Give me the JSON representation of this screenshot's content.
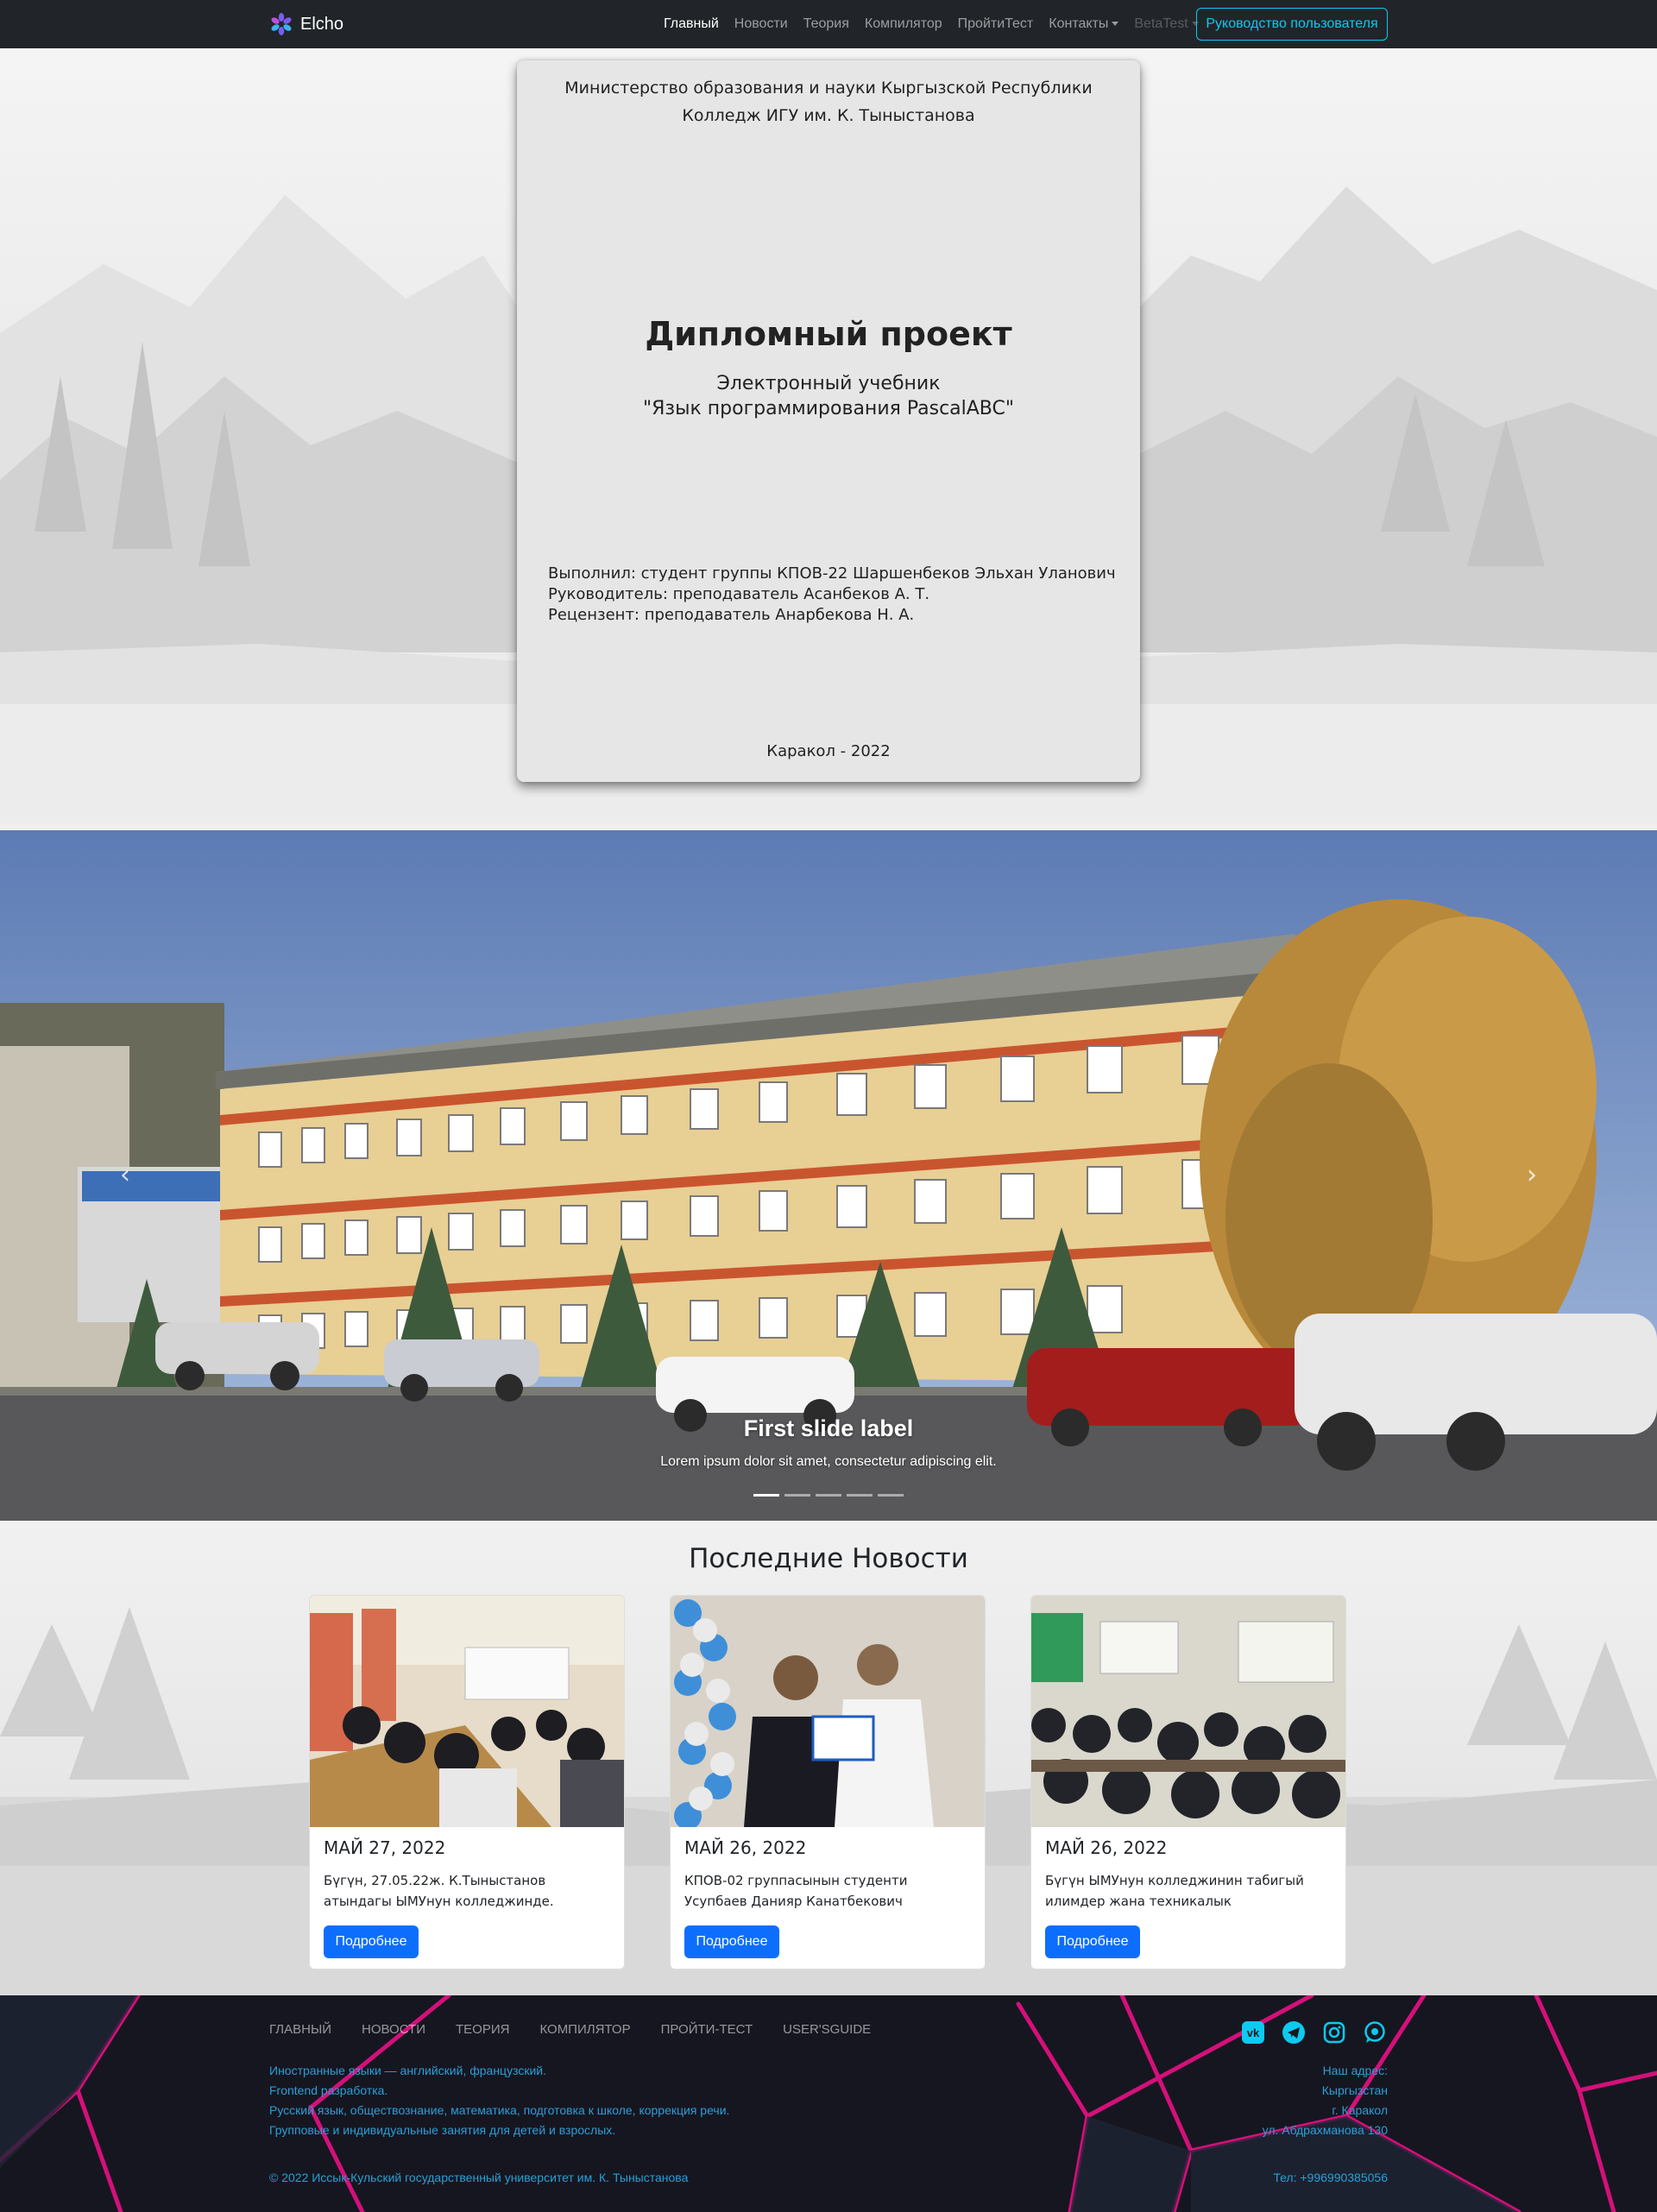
{
  "navbar": {
    "brand": "Elcho",
    "brand_icon": "snowflake-logo-icon",
    "links": [
      {
        "label": "Главный",
        "state": "active"
      },
      {
        "label": "Новости",
        "state": "normal"
      },
      {
        "label": "Теория",
        "state": "normal"
      },
      {
        "label": "Компилятор",
        "state": "normal"
      },
      {
        "label": "ПройтиТест",
        "state": "normal"
      },
      {
        "label": "Контакты",
        "state": "dropdown"
      },
      {
        "label": "BetaTest",
        "state": "disabled-dropdown"
      }
    ],
    "guide_button": "Руководство пользователя",
    "accent": "#0dcaf0"
  },
  "title_page": {
    "ministry": "Министерство образования и науки Кыргызской Республики",
    "college": "Колледж ИГУ им. К. Тыныстанова",
    "title": "Дипломный проект",
    "subtitle": "Электронный учебник",
    "subtitle_2": "\"Язык программирования PascalABC\"",
    "author": "Выполнил: студент группы КПОВ-22 Шаршенбеков Эльхан Уланович",
    "supervisor": "Руководитель: преподаватель Асанбеков А. Т.",
    "reviewer": "Рецензент: преподаватель Анарбекова Н. А.",
    "city_year": "Каракол - 2022"
  },
  "carousel": {
    "caption_title": "First slide label",
    "caption_text": "Lorem ipsum dolor sit amet, consectetur adipiscing elit.",
    "slides_count": 5,
    "active_index": 0,
    "prev_icon": "chevron-left-icon",
    "next_icon": "chevron-right-icon"
  },
  "news": {
    "heading": "Последние Новости",
    "cards": [
      {
        "date": "МАЙ 27, 2022",
        "text": "Бүгүн, 27.05.22ж. К.Тыныстанов атындагы ЫМУнун колледжинде.",
        "button": "Подробнее"
      },
      {
        "date": "МАЙ 26, 2022",
        "text": "КПОВ-02 группасынын студенти Усупбаев Данияр Канатбекович",
        "button": "Подробнее"
      },
      {
        "date": "МАЙ 26, 2022",
        "text": "Бүгүн ЫМУнун колледжинин табигый илимдер жана техникалык",
        "button": "Подробнее"
      }
    ],
    "button_color": "#0d6efd"
  },
  "footer": {
    "links": [
      "Главный",
      "Новости",
      "Теория",
      "Компилятор",
      "Пройти-тест",
      "User'sGuide"
    ],
    "social": [
      "vk-icon",
      "telegram-icon",
      "instagram-icon",
      "whatsapp-icon"
    ],
    "about": [
      "Иностранные языки — английский, французский.",
      "Frontend разработка.",
      "Русский язык, обществознание, математика, подготовка к школе, коррекция речи.",
      "Групповые и индивидуальные занятия для детей и взрослых."
    ],
    "address": [
      "Наш адрес:",
      "Кыргызстан",
      "г. Каракол",
      "ул. Абдрахманова 130"
    ],
    "copyright": "© 2022 Иссык-Кульский государственный университет им. К. Тыныстанова",
    "phone": "Тел: +996990385056",
    "text_color": "#2a9fd6",
    "accent": "#e0107a"
  }
}
